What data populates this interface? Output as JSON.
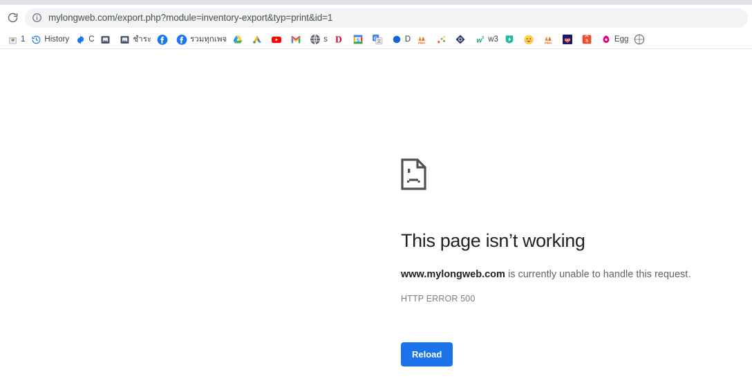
{
  "browser": {
    "reload_icon": "reload-icon",
    "omnibox": {
      "site_info_icon": "info-circle-icon",
      "url": "mylongweb.com/export.php?module=inventory-export&typ=print&id=1"
    }
  },
  "bookmarks": [
    {
      "icon": "chrome-web-store-icon",
      "label": "1"
    },
    {
      "icon": "history-clock-icon",
      "label": "History"
    },
    {
      "icon": "gear-icon",
      "label": "C"
    },
    {
      "icon": "picture-frame-icon",
      "label": ""
    },
    {
      "icon": "picture-frame-icon",
      "label": "ชำระ"
    },
    {
      "icon": "facebook-icon",
      "label": ""
    },
    {
      "icon": "facebook-icon",
      "label": "รวมทุกเพจ"
    },
    {
      "icon": "google-drive-icon",
      "label": ""
    },
    {
      "icon": "google-ads-icon",
      "label": ""
    },
    {
      "icon": "youtube-icon",
      "label": ""
    },
    {
      "icon": "gmail-icon",
      "label": ""
    },
    {
      "icon": "globe-icon",
      "label": "s"
    },
    {
      "icon": "dafont-d-icon",
      "label": ""
    },
    {
      "icon": "google-calendar-icon",
      "label": ""
    },
    {
      "icon": "google-translate-icon",
      "label": ""
    },
    {
      "icon": "blue-dot-icon",
      "label": "D"
    },
    {
      "icon": "pma-icon",
      "label": ""
    },
    {
      "icon": "dots-diagonal-icon",
      "label": ""
    },
    {
      "icon": "diamond-icon",
      "label": ""
    },
    {
      "icon": "w3schools-icon",
      "label": "w3"
    },
    {
      "icon": "green-badge-icon",
      "label": ""
    },
    {
      "icon": "smiley-icon",
      "label": ""
    },
    {
      "icon": "pma-icon",
      "label": ""
    },
    {
      "icon": "lazada-icon",
      "label": ""
    },
    {
      "icon": "shopee-icon",
      "label": ""
    },
    {
      "icon": "egg-icon",
      "label": "Egg"
    },
    {
      "icon": "partial-icon",
      "label": ""
    }
  ],
  "error_page": {
    "icon": "sad-document-icon",
    "title": "This page isn’t working",
    "detail_host": "www.mylongweb.com",
    "detail_rest": " is currently unable to handle this request.",
    "code": "HTTP ERROR 500",
    "reload_label": "Reload"
  },
  "colors": {
    "accent_blue": "#1a73e8",
    "omnibox_bg": "#f1f3f4",
    "tabstrip_bg": "#dee1e6",
    "title_text": "#202124",
    "body_text": "#5f6368"
  }
}
